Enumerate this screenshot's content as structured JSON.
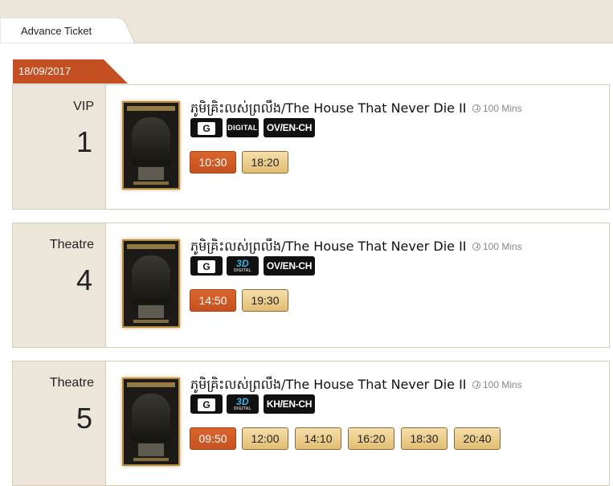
{
  "tab": {
    "label": "Advance Ticket"
  },
  "date": "18/09/2017",
  "colors": {
    "accent": "#c34f22",
    "tab_bg": "#ece5da",
    "time_button": "#e9c98a"
  },
  "shows": [
    {
      "hall_name": "VIP",
      "hall_number": "1",
      "title": "ភូមិគ្រិះលស់ព្រលឹង/The House That Never Die II",
      "duration": "100 Mins",
      "rating": "G",
      "format": "DIGITAL",
      "language": "OV/EN-CH",
      "times": [
        "10:30",
        "18:20"
      ],
      "selected_time": "10:30"
    },
    {
      "hall_name": "Theatre",
      "hall_number": "4",
      "title": "ភូមិគ្រិះលស់ព្រលឹង/The House That Never Die II",
      "duration": "100 Mins",
      "rating": "G",
      "format": "3D DIGITAL",
      "language": "OV/EN-CH",
      "times": [
        "14:50",
        "19:30"
      ],
      "selected_time": "14:50"
    },
    {
      "hall_name": "Theatre",
      "hall_number": "5",
      "title": "ភូមិគ្រិះលស់ព្រលឹង/The House That Never Die II",
      "duration": "100 Mins",
      "rating": "G",
      "format": "3D DIGITAL",
      "language": "KH/EN-CH",
      "times": [
        "09:50",
        "12:00",
        "14:10",
        "16:20",
        "18:30",
        "20:40"
      ],
      "selected_time": "09:50"
    }
  ]
}
